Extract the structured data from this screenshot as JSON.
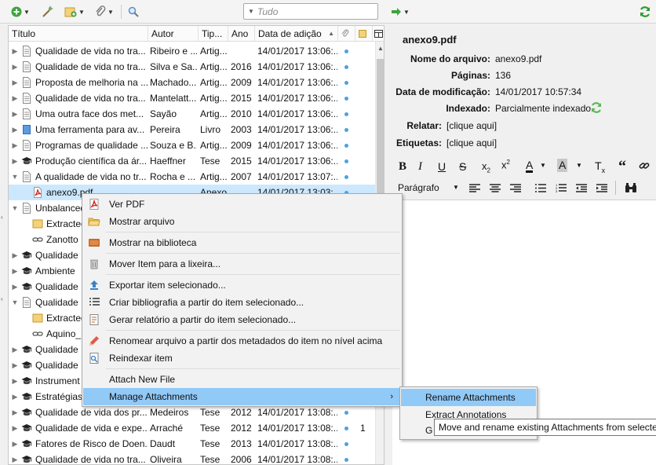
{
  "toolbar": {
    "search_placeholder": "Tudo"
  },
  "columns": {
    "title": "Título",
    "author": "Autor",
    "type": "Tip...",
    "year": "Ano",
    "date_added": "Data de adição",
    "sort_indicator": "▲"
  },
  "rows": [
    {
      "title": "Qualidade de vida no tra...",
      "author": "Ribeiro e ...",
      "type": "Artig...",
      "year": "",
      "date": "14/01/2017 13:06:...",
      "icon": "document-icon"
    },
    {
      "title": "Qualidade de vida no tra...",
      "author": "Silva e Sa...",
      "type": "Artig...",
      "year": "2016",
      "date": "14/01/2017 13:06:...",
      "icon": "document-icon"
    },
    {
      "title": "Proposta de melhoria na ...",
      "author": "Machado...",
      "type": "Artig...",
      "year": "2009",
      "date": "14/01/2017 13:06:...",
      "icon": "document-icon"
    },
    {
      "title": "Qualidade de vida no tra...",
      "author": "Mantelatt...",
      "type": "Artig...",
      "year": "2015",
      "date": "14/01/2017 13:06:...",
      "icon": "document-icon"
    },
    {
      "title": "Uma outra face dos met...",
      "author": "Sayão",
      "type": "Artig...",
      "year": "2010",
      "date": "14/01/2017 13:06:...",
      "icon": "document-icon"
    },
    {
      "title": "Uma ferramenta para av...",
      "author": "Pereira",
      "type": "Livro",
      "year": "2003",
      "date": "14/01/2017 13:06:...",
      "icon": "book-icon"
    },
    {
      "title": "Programas de qualidade ...",
      "author": "Souza e B...",
      "type": "Artig...",
      "year": "2009",
      "date": "14/01/2017 13:06:...",
      "icon": "document-icon"
    },
    {
      "title": "Produção científica da ár...",
      "author": "Haeffner",
      "type": "Tese",
      "year": "2015",
      "date": "14/01/2017 13:06:...",
      "icon": "thesis-icon"
    },
    {
      "title": "A qualidade de vida no tr...",
      "author": "Rocha e ...",
      "type": "Artig...",
      "year": "2007",
      "date": "14/01/2017 13:07:...",
      "icon": "document-icon"
    },
    {
      "title": "anexo9.pdf",
      "author": "",
      "type": "Anexo",
      "year": "",
      "date": "14/01/2017 13:03:...",
      "icon": "pdf-icon"
    },
    {
      "title": "Unbalanced",
      "author": "",
      "type": "",
      "year": "",
      "date": "",
      "icon": "document-icon"
    },
    {
      "title": "Extracted",
      "author": "",
      "type": "",
      "year": "",
      "date": "",
      "icon": "note-icon"
    },
    {
      "title": "Zanotto",
      "author": "",
      "type": "",
      "year": "",
      "date": "",
      "icon": "link-icon"
    },
    {
      "title": "Qualidade",
      "author": "",
      "type": "",
      "year": "",
      "date": "",
      "icon": "thesis-icon"
    },
    {
      "title": "Ambiente",
      "author": "",
      "type": "",
      "year": "",
      "date": "",
      "icon": "thesis-icon"
    },
    {
      "title": "Qualidade",
      "author": "",
      "type": "",
      "year": "",
      "date": "",
      "icon": "thesis-icon"
    },
    {
      "title": "Qualidade",
      "author": "",
      "type": "",
      "year": "",
      "date": "",
      "icon": "document-icon"
    },
    {
      "title": "Extracted",
      "author": "",
      "type": "",
      "year": "",
      "date": "",
      "icon": "note-icon"
    },
    {
      "title": "Aquino_F",
      "author": "",
      "type": "",
      "year": "",
      "date": "",
      "icon": "link-icon"
    },
    {
      "title": "Qualidade",
      "author": "",
      "type": "",
      "year": "",
      "date": "",
      "icon": "thesis-icon"
    },
    {
      "title": "Qualidade",
      "author": "",
      "type": "",
      "year": "",
      "date": "",
      "icon": "thesis-icon"
    },
    {
      "title": "Instrument",
      "author": "",
      "type": "",
      "year": "",
      "date": "",
      "icon": "thesis-icon"
    },
    {
      "title": "Estratégias",
      "author": "",
      "type": "",
      "year": "",
      "date": "",
      "icon": "thesis-icon"
    },
    {
      "title": "Qualidade de vida dos pr...",
      "author": "Medeiros",
      "type": "Tese",
      "year": "2012",
      "date": "14/01/2017 13:08:...",
      "icon": "thesis-icon"
    },
    {
      "title": "Qualidade de vida e expe...",
      "author": "Arraché",
      "type": "Tese",
      "year": "2012",
      "date": "14/01/2017 13:08:...",
      "icon": "thesis-icon",
      "count": "1"
    },
    {
      "title": "Fatores de Risco de Doen...",
      "author": "Daudt",
      "type": "Tese",
      "year": "2013",
      "date": "14/01/2017 13:08:...",
      "icon": "thesis-icon"
    },
    {
      "title": "Qualidade de vida no tra...",
      "author": "Oliveira",
      "type": "Tese",
      "year": "2006",
      "date": "14/01/2017 13:08:...",
      "icon": "thesis-icon"
    }
  ],
  "item_pane": {
    "heading": "anexo9.pdf",
    "fields": [
      {
        "label": "Nome do arquivo:",
        "value": "anexo9.pdf"
      },
      {
        "label": "Páginas:",
        "value": "136"
      },
      {
        "label": "Data de modificação:",
        "value": "14/01/2017 10:57:34"
      },
      {
        "label": "Indexado:",
        "value": "Parcialmente indexado"
      },
      {
        "label": "Relatar:",
        "value": "[clique aqui]"
      },
      {
        "label": "Etiquetas:",
        "value": "[clique aqui]"
      }
    ],
    "format_select": "Parágrafo"
  },
  "context_menu": {
    "items": [
      {
        "label": "Ver PDF",
        "icon": "pdf-icon"
      },
      {
        "label": "Mostrar arquivo",
        "icon": "folder-open-icon"
      },
      {
        "label": "Mostrar na biblioteca",
        "icon": "library-icon"
      },
      {
        "label": "Mover Item para a lixeira...",
        "icon": "trash-icon"
      },
      {
        "label": "Exportar item selecionado...",
        "icon": "export-icon"
      },
      {
        "label": "Criar bibliografia a partir do item selecionado...",
        "icon": "bibliography-icon"
      },
      {
        "label": "Gerar relatório a partir do item selecionado...",
        "icon": "report-icon"
      },
      {
        "label": "Renomear arquivo a partir dos metadados do item no nível acima",
        "icon": "rename-icon"
      },
      {
        "label": "Reindexar item",
        "icon": "reindex-icon"
      },
      {
        "label": "Attach New File",
        "icon": ""
      },
      {
        "label": "Manage Attachments",
        "icon": ""
      }
    ]
  },
  "submenu": {
    "items": [
      {
        "label": "Rename Attachments"
      },
      {
        "label": "Extract Annotations"
      },
      {
        "label": "G"
      }
    ]
  },
  "tooltip": "Move and rename existing Attachments from selecte",
  "colors": {
    "selection": "#cce8ff",
    "menu_highlight": "#91c9f7",
    "accent_green": "#2e9a2e"
  }
}
